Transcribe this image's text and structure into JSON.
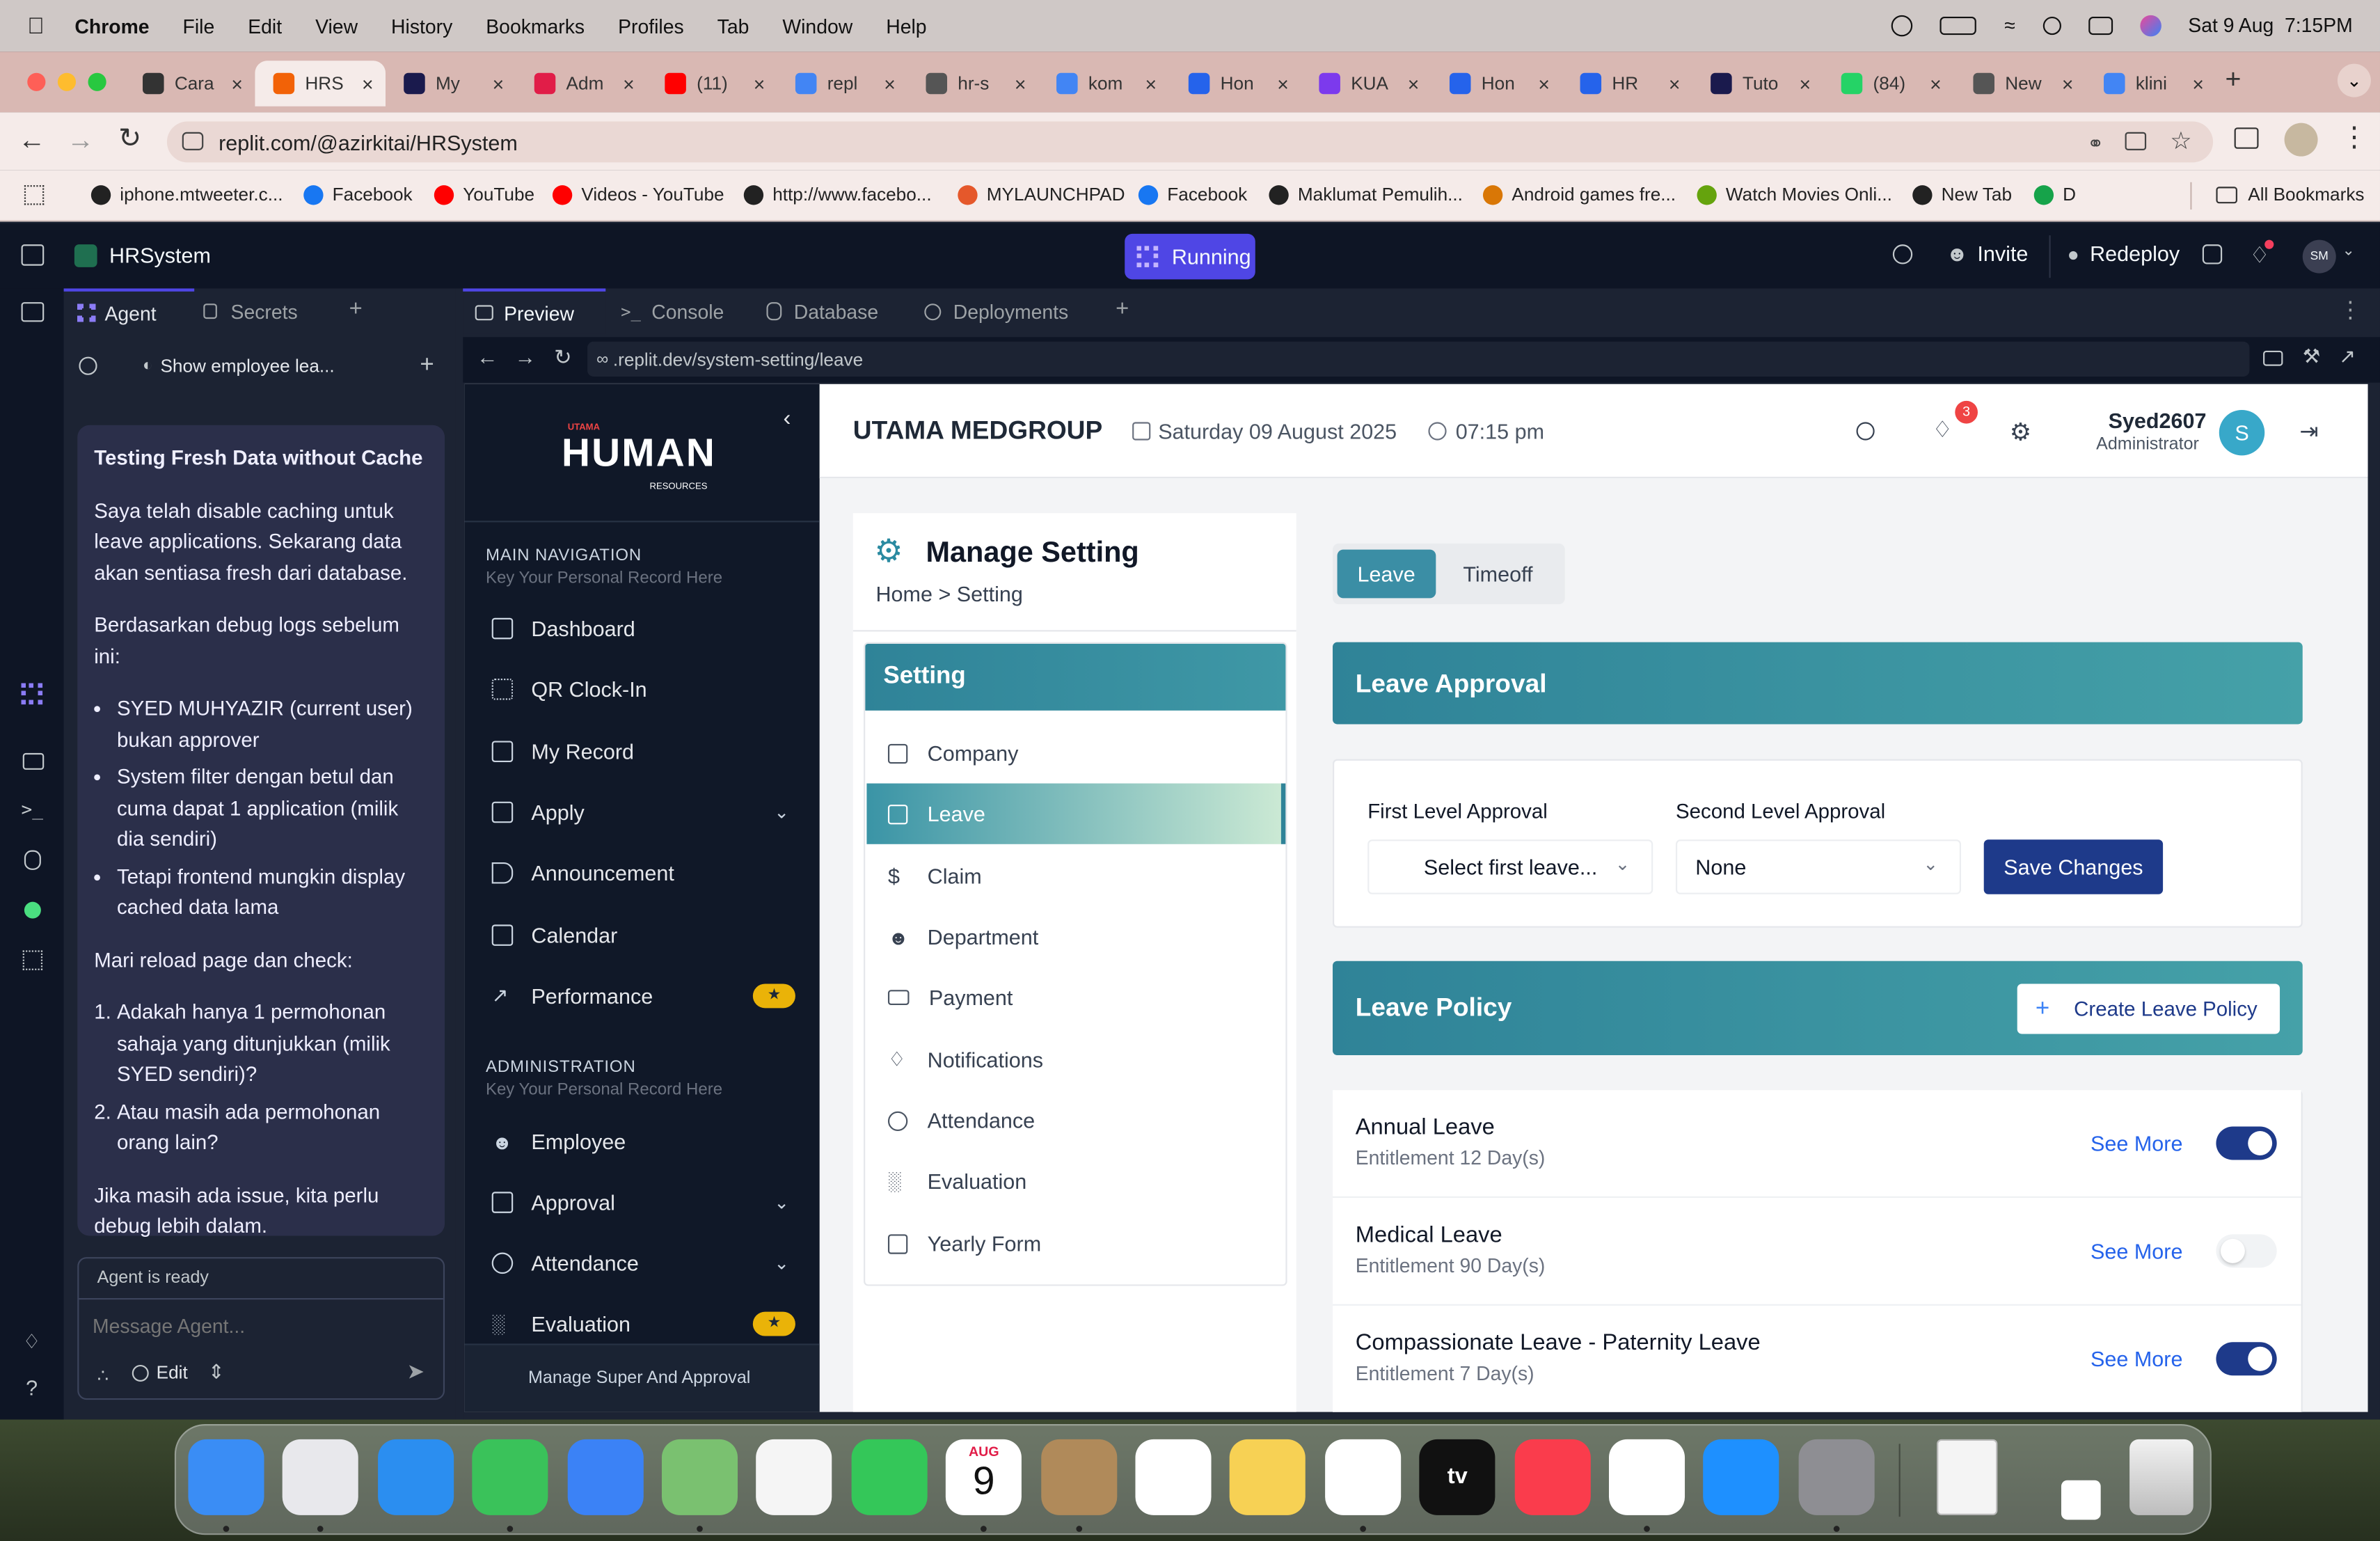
{
  "mac": {
    "app": "Chrome",
    "menu": [
      "File",
      "Edit",
      "View",
      "History",
      "Bookmarks",
      "Profiles",
      "Tab",
      "Window",
      "Help"
    ],
    "datetime": "Sat 9 Aug  7:15PM"
  },
  "browser": {
    "tabs": [
      {
        "label": "Cara",
        "color": "#333333"
      },
      {
        "label": "HRS",
        "color": "#f26207"
      },
      {
        "label": "My",
        "color": "#1a1a4d"
      },
      {
        "label": "Adm",
        "color": "#e11d48"
      },
      {
        "label": "(11)",
        "color": "#ff0000"
      },
      {
        "label": "repl",
        "color": "#4285f4"
      },
      {
        "label": "hr-s",
        "color": "#555555"
      },
      {
        "label": "kom",
        "color": "#4285f4"
      },
      {
        "label": "Hon",
        "color": "#2563eb"
      },
      {
        "label": "KUA",
        "color": "#7c3aed"
      },
      {
        "label": "Hon",
        "color": "#2563eb"
      },
      {
        "label": "HR",
        "color": "#2563eb"
      },
      {
        "label": "Tuto",
        "color": "#1a1a4d"
      },
      {
        "label": "(84)",
        "color": "#25d366"
      },
      {
        "label": "New",
        "color": "#555555"
      },
      {
        "label": "klini",
        "color": "#4285f4"
      }
    ],
    "url": "replit.com/@azirkitai/HRSystem",
    "bookmarks": [
      {
        "label": "iphone.mtweeter.c...",
        "color": "#222222"
      },
      {
        "label": "Facebook",
        "color": "#1877f2"
      },
      {
        "label": "YouTube",
        "color": "#ff0000"
      },
      {
        "label": "Videos - YouTube",
        "color": "#ff0000"
      },
      {
        "label": "http://www.facebo...",
        "color": "#222222"
      },
      {
        "label": "MYLAUNCHPAD",
        "color": "#e5582b"
      },
      {
        "label": "Facebook",
        "color": "#1877f2"
      },
      {
        "label": "Maklumat Pemulih...",
        "color": "#222222"
      },
      {
        "label": "Android games fre...",
        "color": "#d97706"
      },
      {
        "label": "Watch Movies Onli...",
        "color": "#65a30d"
      },
      {
        "label": "New Tab",
        "color": "#222222"
      },
      {
        "label": "D",
        "color": "#16a34a"
      }
    ],
    "all_bookmarks": "All Bookmarks"
  },
  "replit": {
    "project": "HRSystem",
    "status": "Running",
    "invite": "Invite",
    "redeploy": "Redeploy",
    "avatar": "SM",
    "left_tabs": [
      "Agent",
      "Secrets"
    ],
    "history_title": "Show employee lea...",
    "chat": {
      "heading": "Testing Fresh Data without Cache",
      "p1": "Saya telah disable caching untuk leave applications. Sekarang data akan sentiasa fresh dari database.",
      "p2": "Berdasarkan debug logs sebelum ini:",
      "bullets": [
        "SYED MUHYAZIR (current user) bukan approver",
        "System filter dengan betul dan cuma dapat 1 application (milik dia sendiri)",
        "Tetapi frontend mungkin display cached data lama"
      ],
      "p3": "Mari reload page dan check:",
      "numbered": [
        "Adakah hanya 1 permohonan sahaja yang ditunjukkan (milik SYED sendiri)?",
        "Atau masih ada permohonan orang lain?"
      ],
      "p4": "Jika masih ada issue, kita perlu debug lebih dalam."
    },
    "agent_status": "Agent is ready",
    "message_placeholder": "Message Agent...",
    "edit_label": "Edit",
    "preview_tabs": [
      "Preview",
      "Console",
      "Database",
      "Deployments"
    ],
    "preview_url": ".replit.dev/system-setting/leave"
  },
  "hr": {
    "logo_top": "UTAMA",
    "logo_main": "HUMAN",
    "logo_sub": "RESOURCES",
    "main_nav_title": "MAIN NAVIGATION",
    "main_nav_sub": "Key Your Personal Record Here",
    "main_nav": [
      "Dashboard",
      "QR Clock-In",
      "My Record",
      "Apply",
      "Announcement",
      "Calendar",
      "Performance"
    ],
    "admin_title": "ADMINISTRATION",
    "admin_sub": "Key Your Personal Record Here",
    "admin_nav": [
      "Employee",
      "Approval",
      "Attendance",
      "Evaluation"
    ],
    "sidebar_footer": "Manage Super And Approval",
    "company": "UTAMA MEDGROUP",
    "date": "Saturday 09 August 2025",
    "time": "07:15 pm",
    "notif_count": "3",
    "user_name": "Syed2607",
    "user_role": "Administrator",
    "user_initial": "S",
    "page_title": "Manage Setting",
    "breadcrumb": "Home > Setting",
    "setting_header": "Setting",
    "setting_items": [
      "Company",
      "Leave",
      "Claim",
      "Department",
      "Payment",
      "Notifications",
      "Attendance",
      "Evaluation",
      "Yearly Form"
    ],
    "tabs": [
      "Leave",
      "Timeoff"
    ],
    "approval_header": "Leave Approval",
    "first_label": "First Level Approval",
    "first_value": "Select first leave...",
    "second_label": "Second Level Approval",
    "second_value": "None",
    "save": "Save Changes",
    "policy_header": "Leave Policy",
    "create_policy": "Create Leave Policy",
    "see_more": "See More",
    "policies": [
      {
        "name": "Annual Leave",
        "entitlement": "Entitlement 12 Day(s)",
        "enabled": true
      },
      {
        "name": "Medical Leave",
        "entitlement": "Entitlement 90 Day(s)",
        "enabled": false
      },
      {
        "name": "Compassionate Leave - Paternity Leave",
        "entitlement": "Entitlement 7 Day(s)",
        "enabled": true
      }
    ]
  },
  "dock": {
    "calendar_month": "AUG",
    "calendar_day": "9",
    "tv_label": "tv",
    "apps": [
      {
        "name": "finder",
        "color": "#3a8df5"
      },
      {
        "name": "launchpad",
        "color": "#e8e8ec"
      },
      {
        "name": "safari",
        "color": "#2b8ef0"
      },
      {
        "name": "messages",
        "color": "#3ac25a"
      },
      {
        "name": "mail",
        "color": "#3b82f6"
      },
      {
        "name": "maps",
        "color": "#7ac170"
      },
      {
        "name": "photos",
        "color": "#f5f5f5"
      },
      {
        "name": "facetime",
        "color": "#34c759"
      },
      {
        "name": "calendar",
        "color": "#ffffff"
      },
      {
        "name": "contacts",
        "color": "#b08a5a"
      },
      {
        "name": "reminders",
        "color": "#ffffff"
      },
      {
        "name": "notes",
        "color": "#f7d154"
      },
      {
        "name": "freeform",
        "color": "#ffffff"
      },
      {
        "name": "apple-tv",
        "color": "#111111"
      },
      {
        "name": "music",
        "color": "#fa3c4c"
      },
      {
        "name": "chrome",
        "color": "#ffffff"
      },
      {
        "name": "app-store",
        "color": "#1e90ff"
      },
      {
        "name": "system-settings",
        "color": "#8e8e93"
      }
    ]
  }
}
